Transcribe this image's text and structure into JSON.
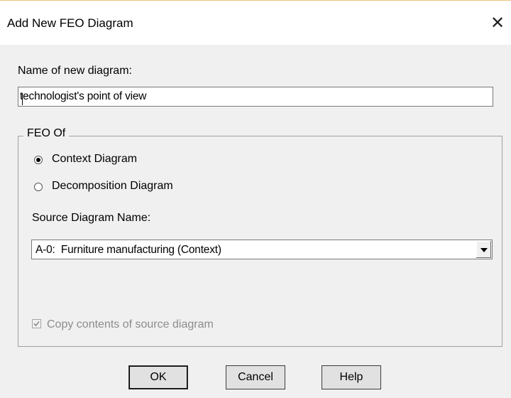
{
  "dialog": {
    "title": "Add New FEO Diagram",
    "close_glyph": "✕"
  },
  "name_field": {
    "label": "Name of new diagram:",
    "value": "technologist's point of view"
  },
  "feo_group": {
    "legend": "FEO Of",
    "options": [
      {
        "label": "Context Diagram",
        "checked": true
      },
      {
        "label": "Decomposition Diagram",
        "checked": false
      }
    ]
  },
  "source": {
    "label": "Source Diagram Name:",
    "selected": "A-0:  Furniture manufacturing (Context)"
  },
  "copy_contents": {
    "label": "Copy contents of source diagram",
    "checked": true,
    "disabled": true
  },
  "buttons": {
    "ok": "OK",
    "cancel": "Cancel",
    "help": "Help"
  },
  "colors": {
    "dialog_bg": "#f0f0f0",
    "disabled_text": "#8c8c8c"
  }
}
